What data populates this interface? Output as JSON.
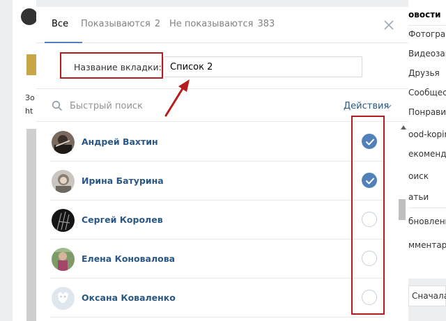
{
  "background": {
    "left_text_1": "Зо",
    "left_text_2": "ht",
    "menu": [
      {
        "label": "овости",
        "active": true
      },
      {
        "label": "Фотограф",
        "active": false
      },
      {
        "label": "Видеозап",
        "active": false
      },
      {
        "label": "Друзья",
        "active": false
      },
      {
        "label": "Сообщест",
        "active": false
      },
      {
        "label": "Понравил",
        "active": false
      },
      {
        "label": "ood-kopirk",
        "active": false
      },
      {
        "label": "екоменда",
        "active": false
      },
      {
        "label": "оиск",
        "active": false
      },
      {
        "label": "атьи",
        "active": false
      },
      {
        "label": "бновлени",
        "active": false
      },
      {
        "label": "мментар",
        "active": false
      }
    ],
    "bottom_button": "Сначала"
  },
  "tabs": [
    {
      "label": "Все",
      "count": "",
      "active": true
    },
    {
      "label": "Показываются",
      "count": "2",
      "active": false
    },
    {
      "label": "Не показываются",
      "count": "383",
      "active": false
    }
  ],
  "name_field": {
    "label": "Название вкладки:",
    "value": "Список 2"
  },
  "search": {
    "placeholder": "Быстрый поиск",
    "actions_label": "Действия"
  },
  "friends": [
    {
      "name": "Андрей Вахтин",
      "checked": true
    },
    {
      "name": "Ирина Батурина",
      "checked": true
    },
    {
      "name": "Сергей Королев",
      "checked": false
    },
    {
      "name": "Елена Коновалова",
      "checked": false
    },
    {
      "name": "Оксана Коваленко",
      "checked": false
    }
  ],
  "colors": {
    "accent": "#5181b8",
    "link": "#2a5885",
    "highlight": "#b71c1c"
  },
  "icons": {
    "close": "close-icon",
    "search": "search-icon",
    "check": "check-icon",
    "chevron": "chevron-down-icon"
  }
}
